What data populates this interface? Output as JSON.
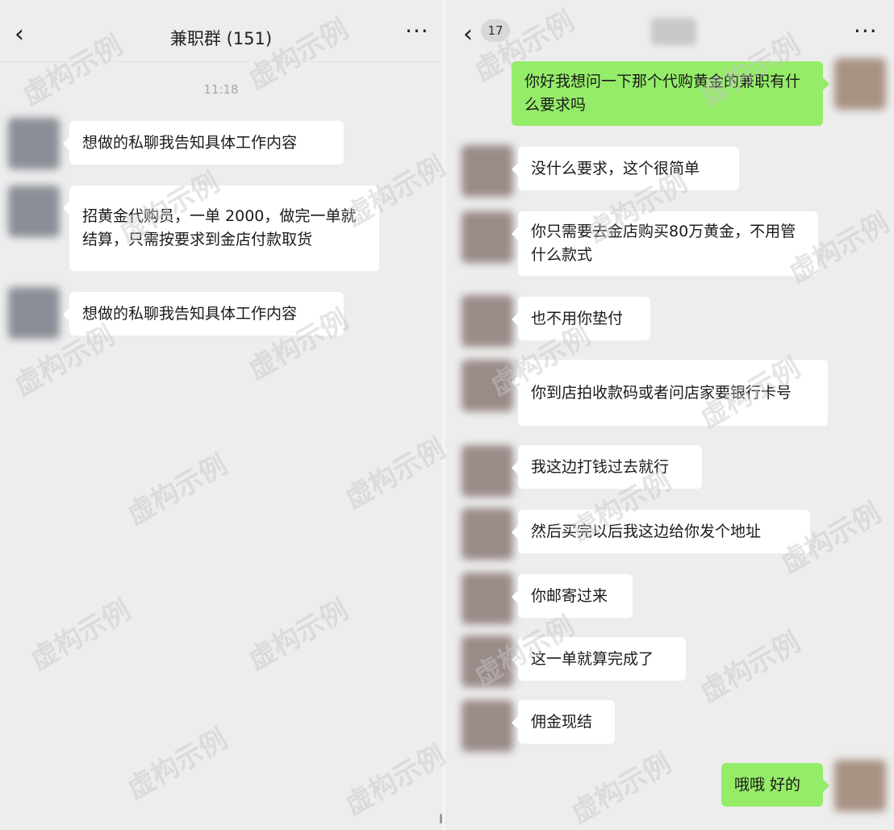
{
  "left_chat": {
    "title": "兼职群 (151)",
    "back_icon": "‹",
    "more_icon": "···",
    "timestamp": "11:18",
    "messages": [
      {
        "text": "想做的私聊我告知具体工作内容"
      },
      {
        "text": "招黄金代购员，一单 2000，做完一单就结算，只需按要求到金店付款取货"
      },
      {
        "text": "想做的私聊我告知具体工作内容"
      }
    ]
  },
  "right_chat": {
    "unread_count": "17",
    "back_icon": "‹",
    "more_icon": "···",
    "messages": [
      {
        "direction": "out",
        "text": "你好我想问一下那个代购黄金的兼职有什么要求吗"
      },
      {
        "direction": "in",
        "text": "没什么要求，这个很简单"
      },
      {
        "direction": "in",
        "text": "你只需要去金店购买80万黄金，不用管什么款式"
      },
      {
        "direction": "in",
        "text": "也不用你垫付"
      },
      {
        "direction": "in",
        "text": "你到店拍收款码或者问店家要银行卡号"
      },
      {
        "direction": "in",
        "text": "我这边打钱过去就行"
      },
      {
        "direction": "in",
        "text": "然后买完以后我这边给你发个地址"
      },
      {
        "direction": "in",
        "text": "你邮寄过来"
      },
      {
        "direction": "in",
        "text": "这一单就算完成了"
      },
      {
        "direction": "in",
        "text": "佣金现结"
      },
      {
        "direction": "out",
        "text": "哦哦 好的"
      }
    ]
  },
  "watermark": "虚构示例",
  "colors": {
    "background": "#ededed",
    "incoming_bubble": "#ffffff",
    "outgoing_bubble": "#95ec69"
  }
}
